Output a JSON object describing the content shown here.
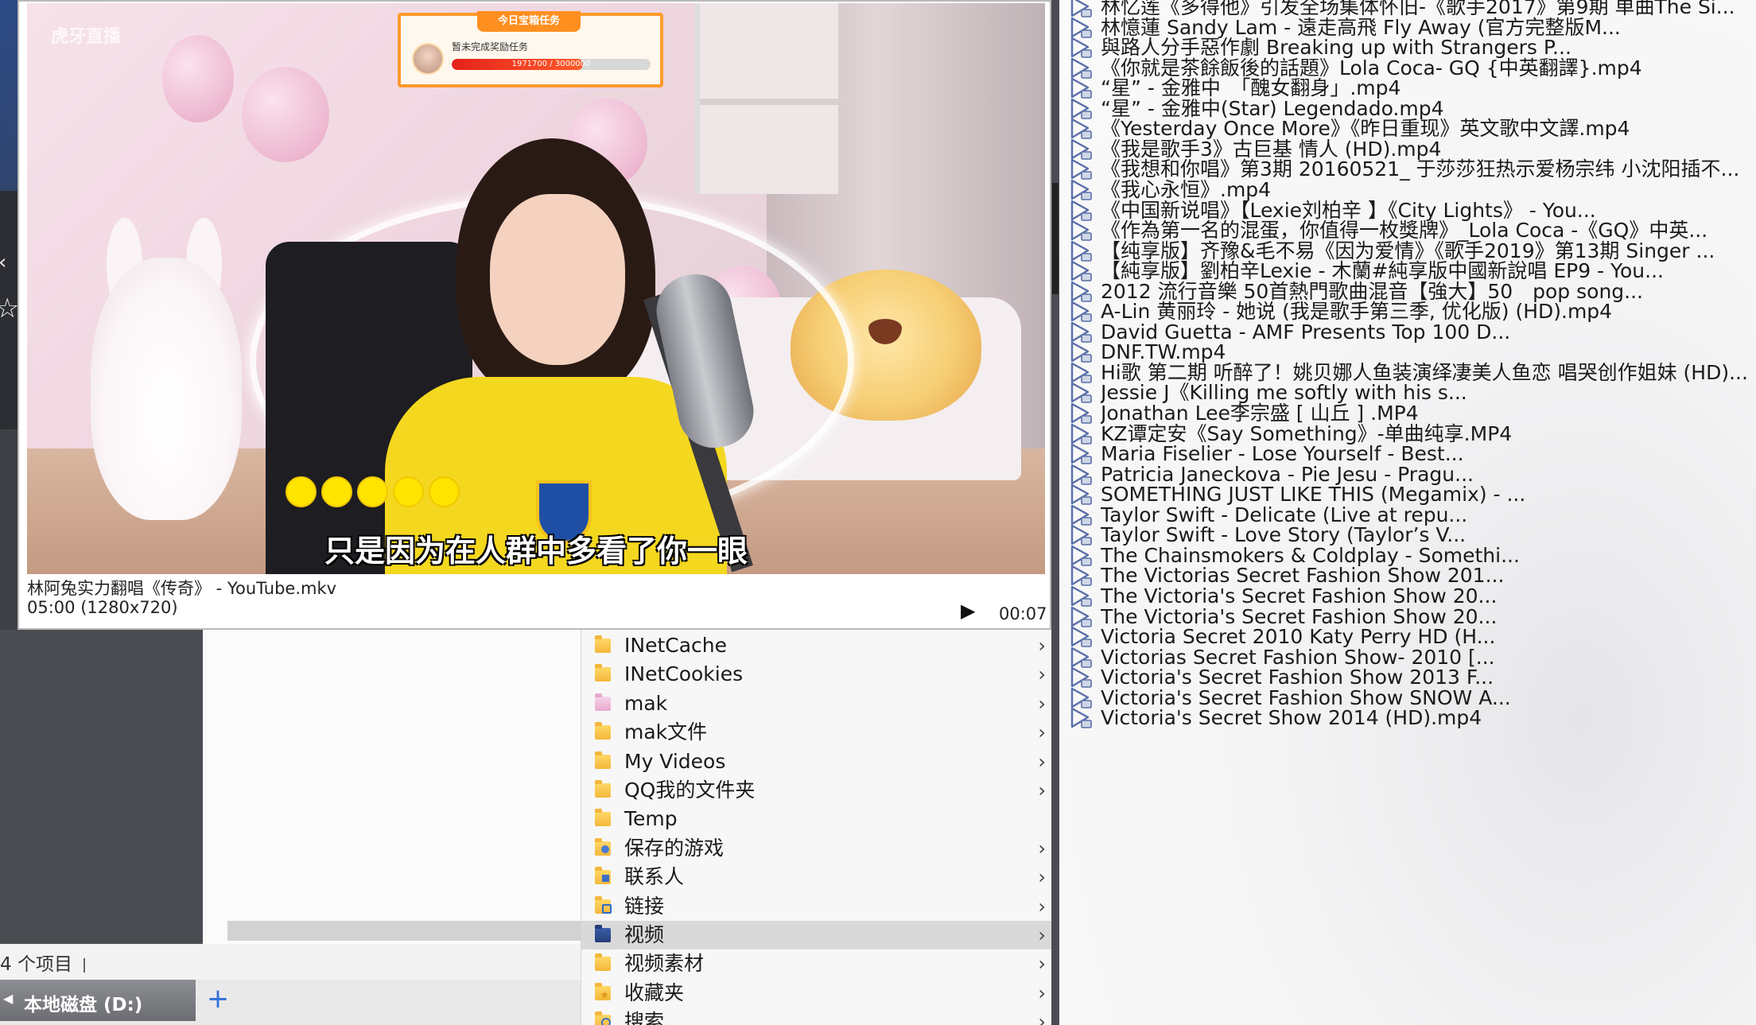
{
  "video_preview": {
    "subtitle": "只是因为在人群中多看了你一眼",
    "filename": "林阿兔实力翻唱《传奇》 - YouTube.mkv",
    "meta": "05:00 (1280x720)",
    "current_time": "00:07",
    "dot_count": 5,
    "task_banner": {
      "title": "今日宝箱任务",
      "text": "暂未完成奖励任务",
      "progress_text": "1971700 / 3000000",
      "progress": 0.66
    },
    "stream_logo": "虎牙直播"
  },
  "folders": [
    {
      "label": "INetCache",
      "icon": "folder-icon",
      "has_chevron": true
    },
    {
      "label": "INetCookies",
      "icon": "folder-icon",
      "has_chevron": true
    },
    {
      "label": "mak",
      "icon": "pink-folder-icon",
      "has_chevron": true
    },
    {
      "label": "mak文件",
      "icon": "folder-icon",
      "has_chevron": true
    },
    {
      "label": "My Videos",
      "icon": "folder-icon",
      "has_chevron": true
    },
    {
      "label": "QQ我的文件夹",
      "icon": "folder-icon",
      "has_chevron": true
    },
    {
      "label": "Temp",
      "icon": "folder-icon",
      "has_chevron": false
    },
    {
      "label": "保存的游戏",
      "icon": "saved-games-icon",
      "has_chevron": true
    },
    {
      "label": "联系人",
      "icon": "contacts-icon",
      "has_chevron": true
    },
    {
      "label": "链接",
      "icon": "links-icon",
      "has_chevron": true
    },
    {
      "label": "视频",
      "icon": "videos-icon",
      "has_chevron": true,
      "selected": true
    },
    {
      "label": "视频素材",
      "icon": "folder-icon",
      "has_chevron": true
    },
    {
      "label": "收藏夹",
      "icon": "favorites-icon",
      "has_chevron": true
    },
    {
      "label": "搜索",
      "icon": "search-folder-icon",
      "has_chevron": true
    }
  ],
  "status_bar": {
    "item_count": "4 个项目"
  },
  "drive_tab": {
    "label": "本地磁盘 (D:)"
  },
  "add_tab_symbol": "+",
  "playlist": [
    "林忆莲《多得他》引发全场集体怀旧-《歌手2017》第9期 单曲The Si...",
    "林憶蓮 Sandy Lam - 遠走高飛 Fly Away (官方完整版M...",
    "與路人分手惡作劇 Breaking up with Strangers P...",
    "《你就是茶餘飯後的話題》Lola Coca- GQ {中英翻譯}.mp4",
    "“星” - 金雅中　「醜女翻身」.mp4",
    "“星” - 金雅中(Star) Legendado.mp4",
    "《Yesterday Once More》《昨日重现》英文歌中文譯.mp4",
    "《我是歌手3》古巨基 情人 (HD).mp4",
    "《我想和你唱》第3期 20160521_ 于莎莎狂热示爱杨宗纬 小沈阳插不...",
    "《我心永恒》.mp4",
    "《中国新说唱》【Lexie刘柏辛 】《City Lights》 - You...",
    "《作為第一名的混蛋，你值得一枚獎牌》_Lola Coca -《GQ》中英...",
    "【纯享版】齐豫&毛不易《因为爱情》《歌手2019》第13期 Singer ...",
    "【純享版】劉柏辛Lexie - 木蘭#純享版中國新說唱 EP9 - You...",
    "2012 流行音樂 50首熱門歌曲混音【強大】50　pop song...",
    "A-Lin 黄丽玲 - 她说 (我是歌手第三季, 优化版) (HD).mp4",
    "David Guetta - AMF Presents Top 100 D...",
    "DNF.TW.mp4",
    "Hi歌 第二期 听醉了！姚贝娜人鱼装演绎凄美人鱼恋 唱哭创作姐妹 (HD)...",
    "Jessie J《Killing me softly with his s...",
    "Jonathan Lee李宗盛 [ 山丘 ] .MP4",
    "KZ谭定安《Say Something》-单曲纯享.MP4",
    "Maria Fiselier - Lose Yourself - Best...",
    "Patricia Janeckova - Pie Jesu - Pragu...",
    "SOMETHING JUST LIKE THIS (Megamix) - ...",
    "Taylor Swift - Delicate (Live at repu...",
    "Taylor Swift - Love Story (Taylor’s V...",
    "The Chainsmokers & Coldplay - Somethi...",
    "The Victorias Secret Fashion Show 201...",
    "The Victoria's Secret Fashion Show 20...",
    "The Victoria's Secret Fashion Show 20...",
    "Victoria Secret 2010 Katy Perry HD (H...",
    "Victorias Secret Fashion Show- 2010 [...",
    "Victoria's Secret Fashion Show 2013 F...",
    "Victoria's Secret Fashion Show SNOW A...",
    "Victoria's Secret Show 2014 (HD).mp4"
  ],
  "colors": {
    "accent_blue": "#2f6fd6",
    "selected_row": "#d9d9d9",
    "subtitle_dots": "#ffe400",
    "banner_orange": "#ff9a2c"
  }
}
